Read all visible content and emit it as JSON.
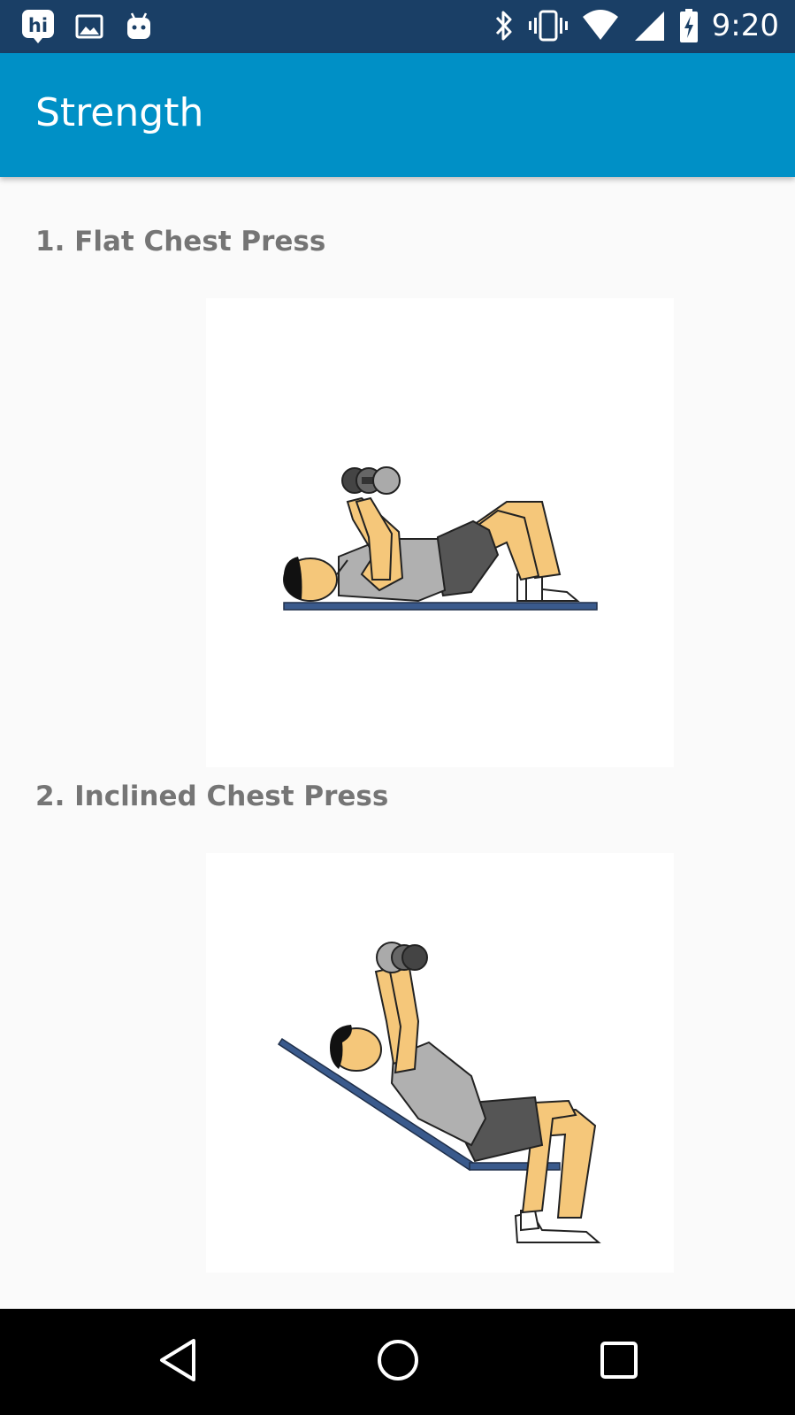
{
  "status_bar": {
    "time": "9:20",
    "left_icons": [
      "hike-icon",
      "image-icon",
      "android-icon"
    ],
    "right_icons": [
      "bluetooth-icon",
      "vibrate-icon",
      "wifi-icon",
      "signal-icon",
      "battery-charging-icon"
    ]
  },
  "app_bar": {
    "title": "Strength",
    "color": "#0090c6"
  },
  "exercises": [
    {
      "label": "1. Flat Chest Press"
    },
    {
      "label": "2. Inclined Chest Press"
    }
  ],
  "nav_bar": {
    "buttons": [
      "back-icon",
      "home-icon",
      "recents-icon"
    ]
  }
}
